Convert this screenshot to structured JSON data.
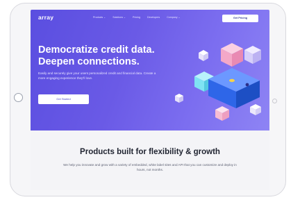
{
  "nav": {
    "logo": "array",
    "menu": [
      "Products ⌄",
      "Solutions ⌄",
      "Pricing",
      "Developers",
      "Company ⌄"
    ],
    "cta": "Get Pricing"
  },
  "hero": {
    "title_line1": "Democratize credit data.",
    "title_line2": "Deepen connections.",
    "subtitle": "Easily and securely give your users personalized credit and financial data. Create a more engaging experience they'll love.",
    "button": "Get Started"
  },
  "section": {
    "title": "Products built for flexibility & growth",
    "body": "We help you innovate and grow with a variety of embedded, white label sites and API that you can customize and deploy in hours, not months."
  },
  "colors": {
    "hero_start": "#5a4ee0",
    "hero_end": "#8e84f4",
    "cube_pink": "#f08fb6",
    "cube_blue": "#2e66e8",
    "cube_cyan": "#7fe3f3"
  }
}
